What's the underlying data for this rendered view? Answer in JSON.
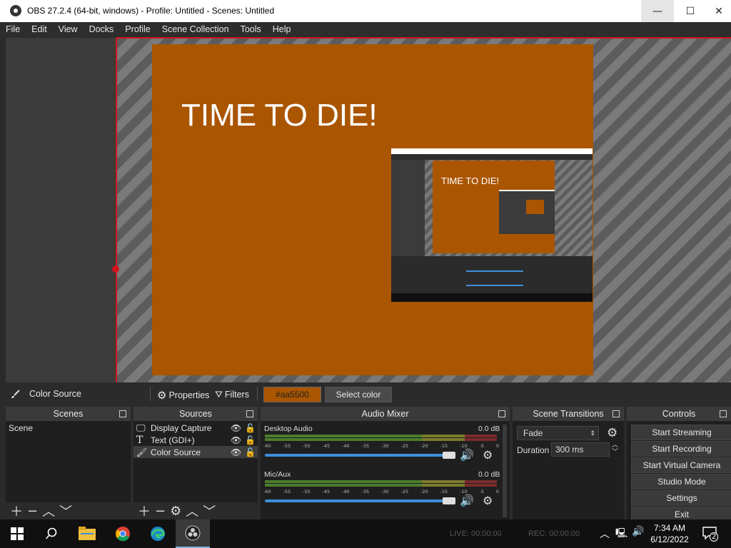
{
  "window": {
    "title": "OBS 27.2.4 (64-bit, windows) - Profile: Untitled - Scenes: Untitled",
    "min_glyph": "—",
    "max_glyph": "☐",
    "close_glyph": "✕"
  },
  "menu": [
    "File",
    "Edit",
    "View",
    "Docks",
    "Profile",
    "Scene Collection",
    "Tools",
    "Help"
  ],
  "preview": {
    "text": "TIME TO DIE!",
    "background_color": "#aa5500",
    "nested_text": "TIME TO DIE!"
  },
  "source_toolbar": {
    "source_name": "Color Source",
    "properties_label": "Properties",
    "filters_label": "Filters",
    "color_value": "#aa5500",
    "select_color_label": "Select color"
  },
  "scenes": {
    "title": "Scenes",
    "items": [
      "Scene"
    ]
  },
  "sources": {
    "title": "Sources",
    "items": [
      {
        "label": "Display Capture",
        "icon": "monitor-icon"
      },
      {
        "label": "Text (GDI+)",
        "icon": "text-icon"
      },
      {
        "label": "Color Source",
        "icon": "brush-icon"
      }
    ]
  },
  "audio_mixer": {
    "title": "Audio Mixer",
    "channels": [
      {
        "name": "Desktop Audio",
        "db": "0.0 dB"
      },
      {
        "name": "Mic/Aux",
        "db": "0.0 dB"
      }
    ],
    "scale": [
      "-60",
      "-55",
      "-50",
      "-45",
      "-40",
      "-35",
      "-30",
      "-25",
      "-20",
      "-15",
      "-10",
      "-5",
      "0"
    ]
  },
  "transitions": {
    "title": "Scene Transitions",
    "selected": "Fade",
    "duration_label": "Duration",
    "duration_value": "300 ms"
  },
  "controls": {
    "title": "Controls",
    "buttons": [
      "Start Streaming",
      "Start Recording",
      "Start Virtual Camera",
      "Studio Mode",
      "Settings",
      "Exit"
    ]
  },
  "status": {
    "live": "LIVE: 00:00:00",
    "rec": "REC: 00:00:00"
  },
  "taskbar": {
    "time": "7:34 AM",
    "date": "6/12/2022",
    "notification_count": "2"
  },
  "colors": {
    "accent_blue": "#3d8fd8",
    "record_red": "#d0141b"
  }
}
